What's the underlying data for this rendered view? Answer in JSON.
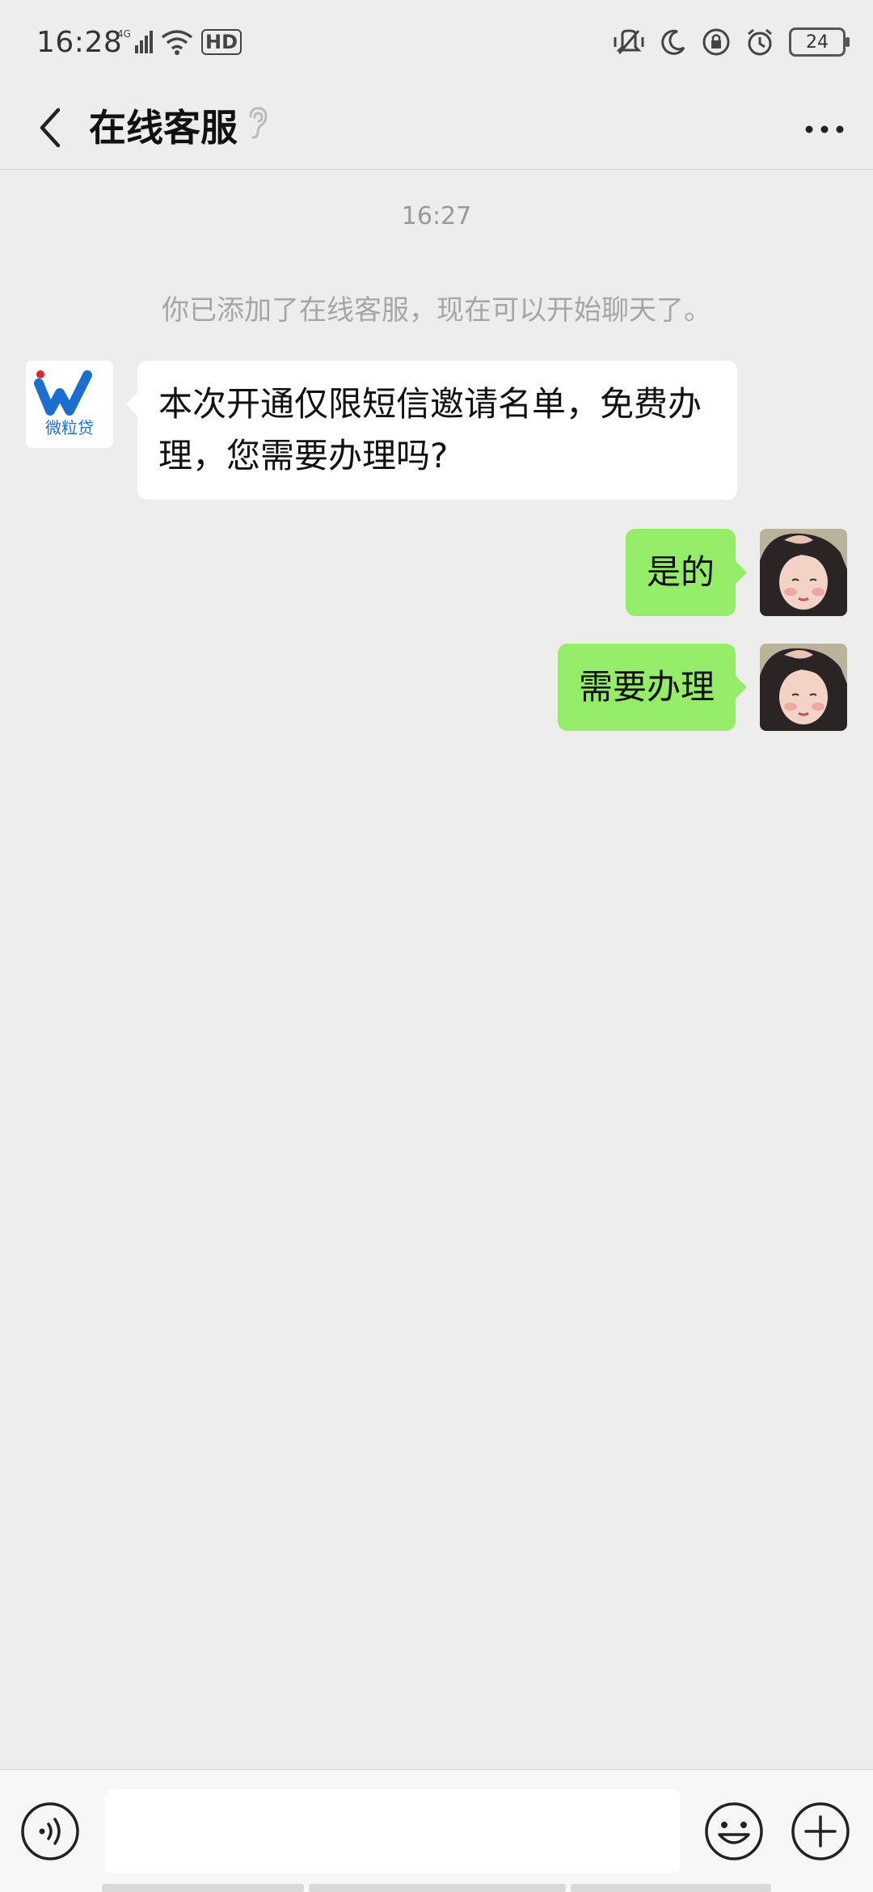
{
  "status_bar": {
    "time": "16:28",
    "network": "4G",
    "hd_label": "HD",
    "battery": "24"
  },
  "header": {
    "title": "在线客服",
    "icons": [
      "back-icon",
      "ear-icon",
      "more-icon"
    ]
  },
  "chat": {
    "timestamp": "16:27",
    "system_notice": "你已添加了在线客服，现在可以开始聊天了。",
    "agent": {
      "avatar_logo_text": "微粒贷",
      "brand_colors": {
        "blue": "#1a6fd1",
        "red": "#e8202a"
      }
    },
    "messages": [
      {
        "side": "left",
        "text": "本次开通仅限短信邀请名单，免费办理，您需要办理吗?"
      },
      {
        "side": "right",
        "text": "是的"
      },
      {
        "side": "right",
        "text": "需要办理"
      }
    ]
  },
  "input_bar": {
    "value": "",
    "placeholder": "",
    "icons": [
      "voice-icon",
      "emoji-icon",
      "plus-icon"
    ]
  },
  "colors": {
    "background": "#ededed",
    "sent_bubble": "#95ec69",
    "received_bubble": "#ffffff"
  }
}
